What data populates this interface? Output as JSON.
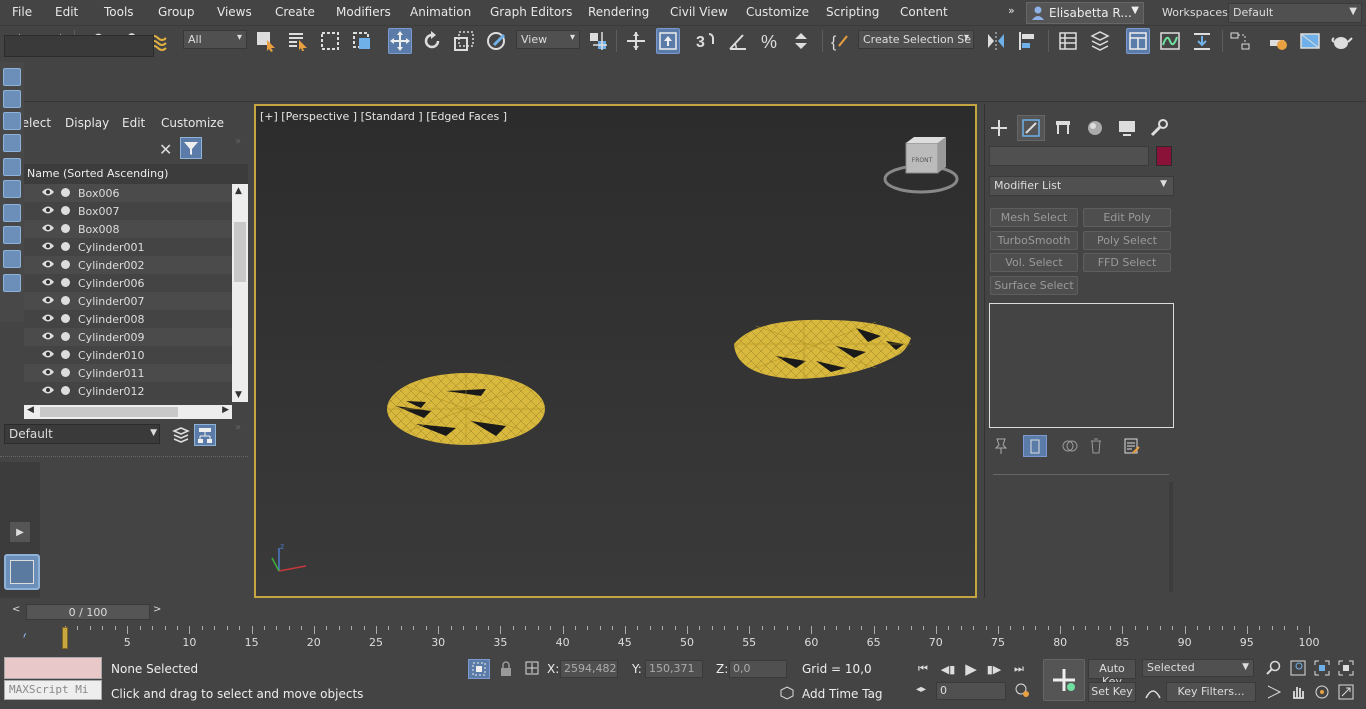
{
  "menu": [
    "File",
    "Edit",
    "Tools",
    "Group",
    "Views",
    "Create",
    "Modifiers",
    "Animation",
    "Graph Editors",
    "Rendering",
    "Civil View",
    "Customize",
    "Scripting",
    "Content"
  ],
  "user": {
    "name": "Elisabetta R..."
  },
  "workspaces": {
    "label": "Workspaces:",
    "value": "Default"
  },
  "toolbar": {
    "selection_filter": "All",
    "ref_coord": "View",
    "named_selection": "Create Selection Se"
  },
  "scene_explorer": {
    "tabs": [
      "Select",
      "Display",
      "Edit",
      "Customize"
    ],
    "column_header": "Name (Sorted Ascending)",
    "objects": [
      "Box006",
      "Box007",
      "Box008",
      "Cylinder001",
      "Cylinder002",
      "Cylinder006",
      "Cylinder007",
      "Cylinder008",
      "Cylinder009",
      "Cylinder010",
      "Cylinder011",
      "Cylinder012"
    ],
    "layer": "Default"
  },
  "viewport": {
    "label": "[+] [Perspective ] [Standard ] [Edged Faces ]",
    "viewcube_face": "FRONT"
  },
  "command_panel": {
    "modifier_list": "Modifier List",
    "color": "#8a1238",
    "modifier_buttons": [
      "Mesh Select",
      "Edit Poly",
      "TurboSmooth",
      "Poly Select",
      "Vol. Select",
      "FFD Select",
      "Surface Select"
    ]
  },
  "timeline": {
    "frame_display": "0 / 100",
    "ticks": [
      0,
      5,
      10,
      15,
      20,
      25,
      30,
      35,
      40,
      45,
      50,
      55,
      60,
      65,
      70,
      75,
      80,
      85,
      90,
      95,
      100
    ]
  },
  "status": {
    "selection": "None Selected",
    "prompt": "Click and drag to select and move objects",
    "maxscript": "MAXScript Mi",
    "x_label": "X:",
    "x_value": "2594,482",
    "y_label": "Y:",
    "y_value": "150,371",
    "z_label": "Z:",
    "z_value": "0,0",
    "grid": "Grid = 10,0",
    "add_time_tag": "Add Time Tag",
    "auto_key": "Auto Key",
    "set_key": "Set Key",
    "key_mode": "Selected",
    "key_filters": "Key Filters...",
    "current_frame": "0"
  }
}
